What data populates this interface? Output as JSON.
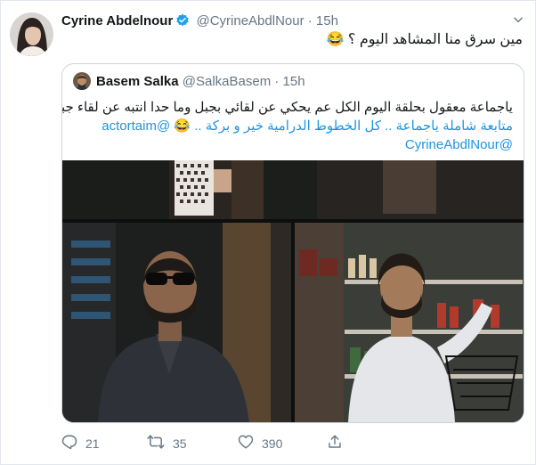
{
  "tweet": {
    "author_name": "Cyrine Abdelnour",
    "author_handle": "@CyrineAbdlNour",
    "separator": "·",
    "time": "15h",
    "text": "مين سرق منا المشاهد اليوم ؟ 😂"
  },
  "quoted_tweet": {
    "author_name": "Basem Salka",
    "author_handle": "@SalkaBasem",
    "separator": "·",
    "time": "15h",
    "text_lines": [
      "ياجماعة معقول بحلقة اليوم الكل عم يحكي عن لقائي بجبل وما حدا انتبه عن لقاء جبل ب نور..؟! بتمنى",
      "متابعة شاملة ياجماعة .. كل الخطوط الدرامية خير و بركة .. 😂 @actortaim",
      "@CyrineAbdlNour"
    ]
  },
  "actions": {
    "replies": "21",
    "retweets": "35",
    "likes": "390"
  },
  "icons": {
    "verified": "verified-badge-icon",
    "caret": "chevron-down-icon",
    "reply": "reply-icon",
    "retweet": "retweet-icon",
    "like": "heart-icon",
    "share": "share-icon"
  },
  "colors": {
    "verified": "#1da1f2",
    "link": "#1b95e0",
    "muted": "#657786",
    "border": "#e1e8ed"
  }
}
